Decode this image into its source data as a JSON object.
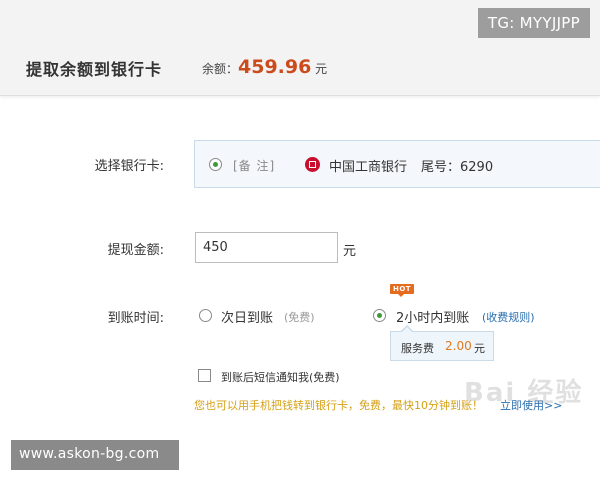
{
  "header": {
    "title": "提取余额到银行卡",
    "balance_label": "余额：",
    "balance_amount": "459.96",
    "balance_unit": "元"
  },
  "overlay": {
    "tg_badge": "TG: MYYJJPP",
    "site_badge": "www.askon-bg.com",
    "watermark": "Baiåº¦ 经验"
  },
  "form": {
    "bank_card": {
      "label": "选择银行卡:",
      "remark": "[备 注]",
      "bank_name": "中国工商银行",
      "tail_label": "尾号：",
      "tail_number": "6290",
      "selected": true
    },
    "amount": {
      "label": "提现金额:",
      "value": "450",
      "unit": "元"
    },
    "arrival_time": {
      "label": "到账时间:",
      "options": [
        {
          "label": "次日到账",
          "note": "(免费)",
          "selected": false
        },
        {
          "label": "2小时内到账",
          "note": "(收费规则)",
          "selected": true,
          "hot_badge": "HOT"
        }
      ],
      "fee_label": "服务费",
      "fee_value": "2.00",
      "fee_unit": "元"
    },
    "sms_notify": {
      "label": "到账后短信通知我(免费)",
      "checked": false
    },
    "tip": "您也可以用手机把钱转到银行卡，免费，最快10分钟到账！",
    "tip_link": "立即使用>>"
  },
  "colors": {
    "accent_amount": "#cc4b1c",
    "link": "#2a6fb0",
    "tip": "#d4a015",
    "fee": "#e07a1f",
    "radio_checked": "#3c9a3c"
  }
}
